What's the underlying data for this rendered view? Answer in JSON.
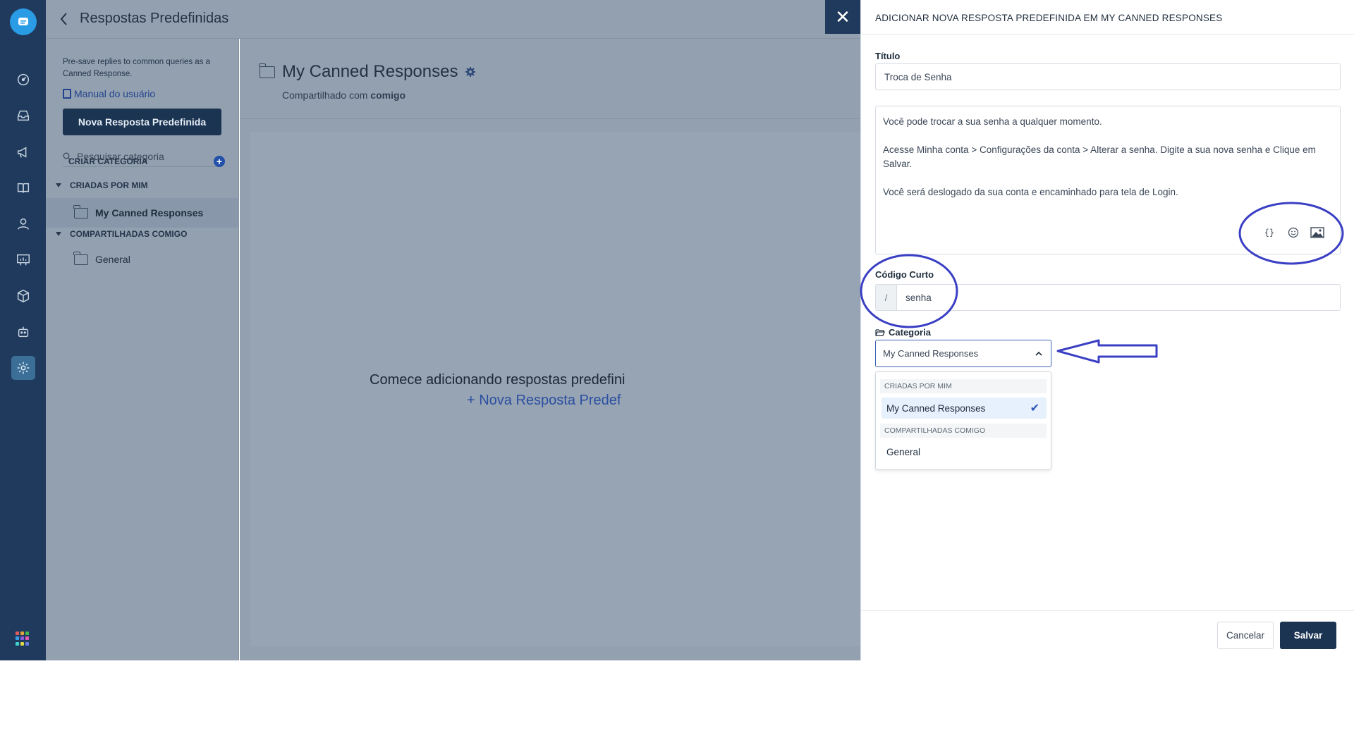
{
  "header": {
    "title": "Respostas Predefinidas",
    "back_icon": "chevron-left-icon"
  },
  "rail": {
    "items": [
      "logo-chat-icon",
      "dashboard-icon",
      "inbox-icon",
      "megaphone-icon",
      "book-icon",
      "contacts-icon",
      "reports-icon",
      "package-icon",
      "bot-icon",
      "settings-icon"
    ],
    "active": "settings-icon"
  },
  "sidebar": {
    "description": "Pre-save replies to common queries as a Canned Response.",
    "manual_link": "Manual do usuário",
    "new_button": "Nova Resposta Predefinida",
    "search_placeholder": "Pesquisar categoria",
    "create_category": "CRIAR CATEGORIA",
    "created_by_me": "CRIADAS POR MIM",
    "shared_with_me": "COMPARTILHADAS COMIGO",
    "created_items": [
      "My Canned Responses"
    ],
    "shared_items": [
      "General"
    ]
  },
  "main": {
    "title": "My Canned Responses",
    "shared_prefix": "Compartilhado com ",
    "shared_with": "comigo",
    "empty_text": "Comece adicionando respostas predefini",
    "empty_link": "+ Nova Resposta Predef"
  },
  "drawer": {
    "title": "ADICIONAR NOVA RESPOSTA PREDEFINIDA EM MY CANNED RESPONSES",
    "title_label": "Título",
    "title_value": "Troca de Senha",
    "body": [
      "Você pode trocar a sua senha a qualquer momento.",
      "Acesse Minha conta > Configurações da conta > Alterar a senha. Digite a sua nova senha e Clique em Salvar.",
      "Você será deslogado da sua conta e encaminhado para tela de Login."
    ],
    "tools": {
      "variables": "{}"
    },
    "shortcode_label": "Código Curto",
    "shortcode_prefix": "/",
    "shortcode_value": "senha",
    "category_label": "Categoria",
    "category_value": "My Canned Responses",
    "dropdown": {
      "group1": "CRIADAS POR MIM",
      "option1": "My Canned Responses",
      "group2": "COMPARTILHADAS COMIGO",
      "option2": "General"
    },
    "cancel": "Cancelar",
    "save": "Salvar"
  },
  "colors": {
    "rail": "#1f3a5c",
    "overlay": "#92a0b0",
    "primary_button": "#1b3452",
    "annotation": "#3a3fc4"
  }
}
